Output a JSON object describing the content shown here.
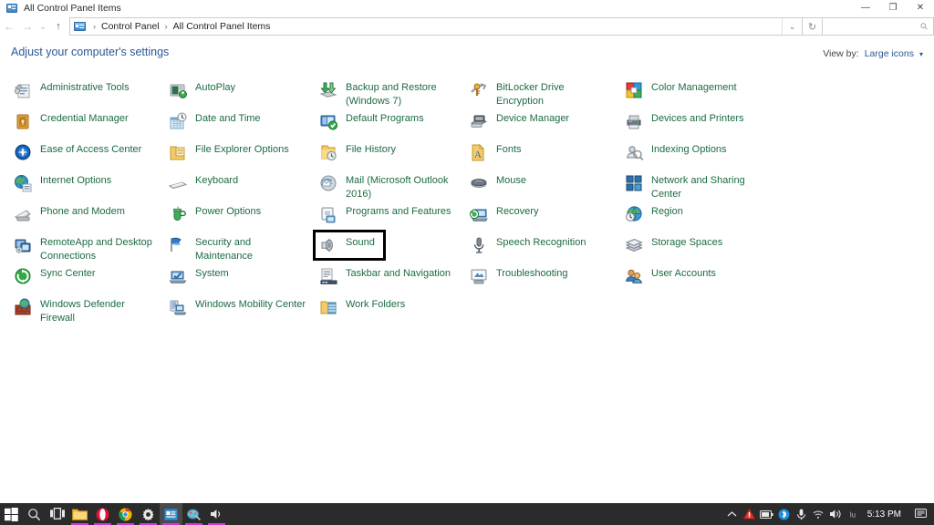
{
  "window": {
    "title": "All Control Panel Items",
    "icon": "control-panel-icon",
    "controls": {
      "minimize": "—",
      "maximize": "❐",
      "close": "✕"
    }
  },
  "toolbar": {
    "back": "←",
    "forward": "→",
    "recent": "⌄",
    "up": "↑",
    "address": {
      "icon": "control-panel-icon",
      "crumbs": [
        "Control Panel",
        "All Control Panel Items"
      ],
      "separator": "›",
      "dropdown_caret": "⌄"
    },
    "refresh": "↻",
    "search": {
      "placeholder": "",
      "value": "",
      "icon": "search-icon"
    }
  },
  "header": {
    "page_title": "Adjust your computer's settings",
    "view_by_label": "View by:",
    "view_by_value": "Large icons",
    "view_by_caret": "▾"
  },
  "selection": {
    "selected_item": "Sound"
  },
  "colors": {
    "link_green": "#1c6b42",
    "title_blue": "#2b5797",
    "taskbar": "#2b2b2b",
    "selection_outline": "#000000",
    "running_indicator": "#d23ad2"
  },
  "columns": [
    {
      "items": [
        {
          "label": "Administrative Tools",
          "icon": "administrative-tools-icon"
        },
        {
          "label": "Credential Manager",
          "icon": "credential-manager-icon"
        },
        {
          "label": "Ease of Access Center",
          "icon": "ease-of-access-icon"
        },
        {
          "label": "Internet Options",
          "icon": "internet-options-icon"
        },
        {
          "label": "Phone and Modem",
          "icon": "phone-and-modem-icon"
        },
        {
          "label": "RemoteApp and Desktop Connections",
          "icon": "remoteapp-icon"
        },
        {
          "label": "Sync Center",
          "icon": "sync-center-icon"
        },
        {
          "label": "Windows Defender Firewall",
          "icon": "windows-defender-firewall-icon"
        }
      ]
    },
    {
      "items": [
        {
          "label": "AutoPlay",
          "icon": "autoplay-icon"
        },
        {
          "label": "Date and Time",
          "icon": "date-and-time-icon"
        },
        {
          "label": "File Explorer Options",
          "icon": "file-explorer-options-icon"
        },
        {
          "label": "Keyboard",
          "icon": "keyboard-icon"
        },
        {
          "label": "Power Options",
          "icon": "power-options-icon"
        },
        {
          "label": "Security and Maintenance",
          "icon": "security-and-maintenance-icon"
        },
        {
          "label": "System",
          "icon": "system-icon"
        },
        {
          "label": "Windows Mobility Center",
          "icon": "windows-mobility-center-icon"
        }
      ]
    },
    {
      "items": [
        {
          "label": "Backup and Restore (Windows 7)",
          "icon": "backup-and-restore-icon"
        },
        {
          "label": "Default Programs",
          "icon": "default-programs-icon"
        },
        {
          "label": "File History",
          "icon": "file-history-icon"
        },
        {
          "label": "Mail (Microsoft Outlook 2016)",
          "icon": "mail-icon"
        },
        {
          "label": "Programs and Features",
          "icon": "programs-and-features-icon"
        },
        {
          "label": "Sound",
          "icon": "sound-icon",
          "selected": true
        },
        {
          "label": "Taskbar and Navigation",
          "icon": "taskbar-and-navigation-icon"
        },
        {
          "label": "Work Folders",
          "icon": "work-folders-icon"
        }
      ]
    },
    {
      "items": [
        {
          "label": "BitLocker Drive Encryption",
          "icon": "bitlocker-icon"
        },
        {
          "label": "Device Manager",
          "icon": "device-manager-icon"
        },
        {
          "label": "Fonts",
          "icon": "fonts-icon"
        },
        {
          "label": "Mouse",
          "icon": "mouse-icon"
        },
        {
          "label": "Recovery",
          "icon": "recovery-icon"
        },
        {
          "label": "Speech Recognition",
          "icon": "speech-recognition-icon"
        },
        {
          "label": "Troubleshooting",
          "icon": "troubleshooting-icon"
        }
      ]
    },
    {
      "items": [
        {
          "label": "Color Management",
          "icon": "color-management-icon"
        },
        {
          "label": "Devices and Printers",
          "icon": "devices-and-printers-icon"
        },
        {
          "label": "Indexing Options",
          "icon": "indexing-options-icon"
        },
        {
          "label": "Network and Sharing Center",
          "icon": "network-and-sharing-icon"
        },
        {
          "label": "Region",
          "icon": "region-icon"
        },
        {
          "label": "Storage Spaces",
          "icon": "storage-spaces-icon"
        },
        {
          "label": "User Accounts",
          "icon": "user-accounts-icon"
        }
      ]
    }
  ],
  "taskbar": {
    "start": "start-button",
    "buttons": [
      {
        "name": "start-button",
        "icon": "windows-logo-icon",
        "running": false
      },
      {
        "name": "search-button",
        "icon": "search-icon",
        "running": false
      },
      {
        "name": "task-view-button",
        "icon": "task-view-icon",
        "running": false
      },
      {
        "name": "file-explorer-button",
        "icon": "folder-icon",
        "running": true
      },
      {
        "name": "opera-button",
        "icon": "opera-icon",
        "running": true
      },
      {
        "name": "chrome-button",
        "icon": "chrome-icon",
        "running": true
      },
      {
        "name": "settings-button",
        "icon": "gear-icon",
        "running": true
      },
      {
        "name": "control-panel-button",
        "icon": "control-panel-icon",
        "running": true,
        "active": true
      },
      {
        "name": "paint-button",
        "icon": "paint-icon",
        "running": true
      },
      {
        "name": "volume-app-button",
        "icon": "speaker-icon",
        "running": true
      }
    ],
    "tray": [
      {
        "name": "show-hidden-icons",
        "icon": "chevron-up-icon"
      },
      {
        "name": "warning-icon",
        "icon": "warning-triangle-icon"
      },
      {
        "name": "battery-icon",
        "icon": "battery-icon"
      },
      {
        "name": "bluetooth-icon",
        "icon": "bluetooth-icon"
      },
      {
        "name": "microphone-icon",
        "icon": "microphone-icon"
      },
      {
        "name": "wifi-icon",
        "icon": "wifi-icon"
      },
      {
        "name": "volume-icon",
        "icon": "speaker-icon"
      },
      {
        "name": "keyboard-layout-icon",
        "icon": "input-indicator-icon"
      }
    ],
    "clock": "5:13 PM",
    "action_center": "action-center-icon"
  }
}
